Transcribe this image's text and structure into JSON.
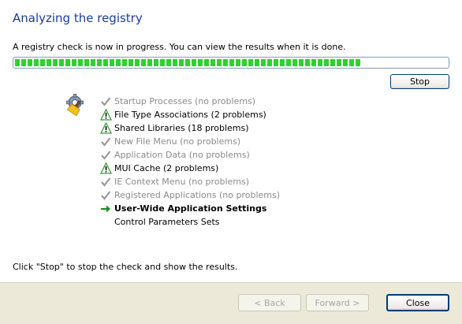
{
  "page": {
    "title": "Analyzing the registry",
    "description": "A registry check is now in progress. You can view the results when it is done.",
    "progress": 0.8,
    "stop_label": "Stop",
    "hint": "Click \"Stop\" to stop the check and show the results."
  },
  "steps": [
    {
      "label": "Startup Processes (no problems)",
      "status": "done",
      "icon": "check-icon"
    },
    {
      "label": "File Type Associations (2 problems)",
      "status": "warn",
      "icon": "warning-icon"
    },
    {
      "label": "Shared Libraries (18 problems)",
      "status": "warn",
      "icon": "warning-icon"
    },
    {
      "label": "New File Menu (no problems)",
      "status": "done",
      "icon": "check-icon"
    },
    {
      "label": "Application Data (no problems)",
      "status": "done",
      "icon": "check-icon"
    },
    {
      "label": "MUI Cache (2 problems)",
      "status": "warn",
      "icon": "warning-icon"
    },
    {
      "label": "IE Context Menu (no problems)",
      "status": "done",
      "icon": "check-icon"
    },
    {
      "label": "Registered Applications (no problems)",
      "status": "done",
      "icon": "check-icon"
    },
    {
      "label": "User-Wide Application Settings",
      "status": "current",
      "icon": "arrow-right-icon"
    },
    {
      "label": "Control Parameters Sets",
      "status": "pending",
      "icon": ""
    }
  ],
  "footer": {
    "back_label": "< Back",
    "forward_label": "Forward >",
    "close_label": "Close"
  },
  "colors": {
    "title": "#1a3d9c",
    "progress": "#2fd12f",
    "done_text": "#8a8a8a",
    "footer_bg": "#ece9d8"
  }
}
